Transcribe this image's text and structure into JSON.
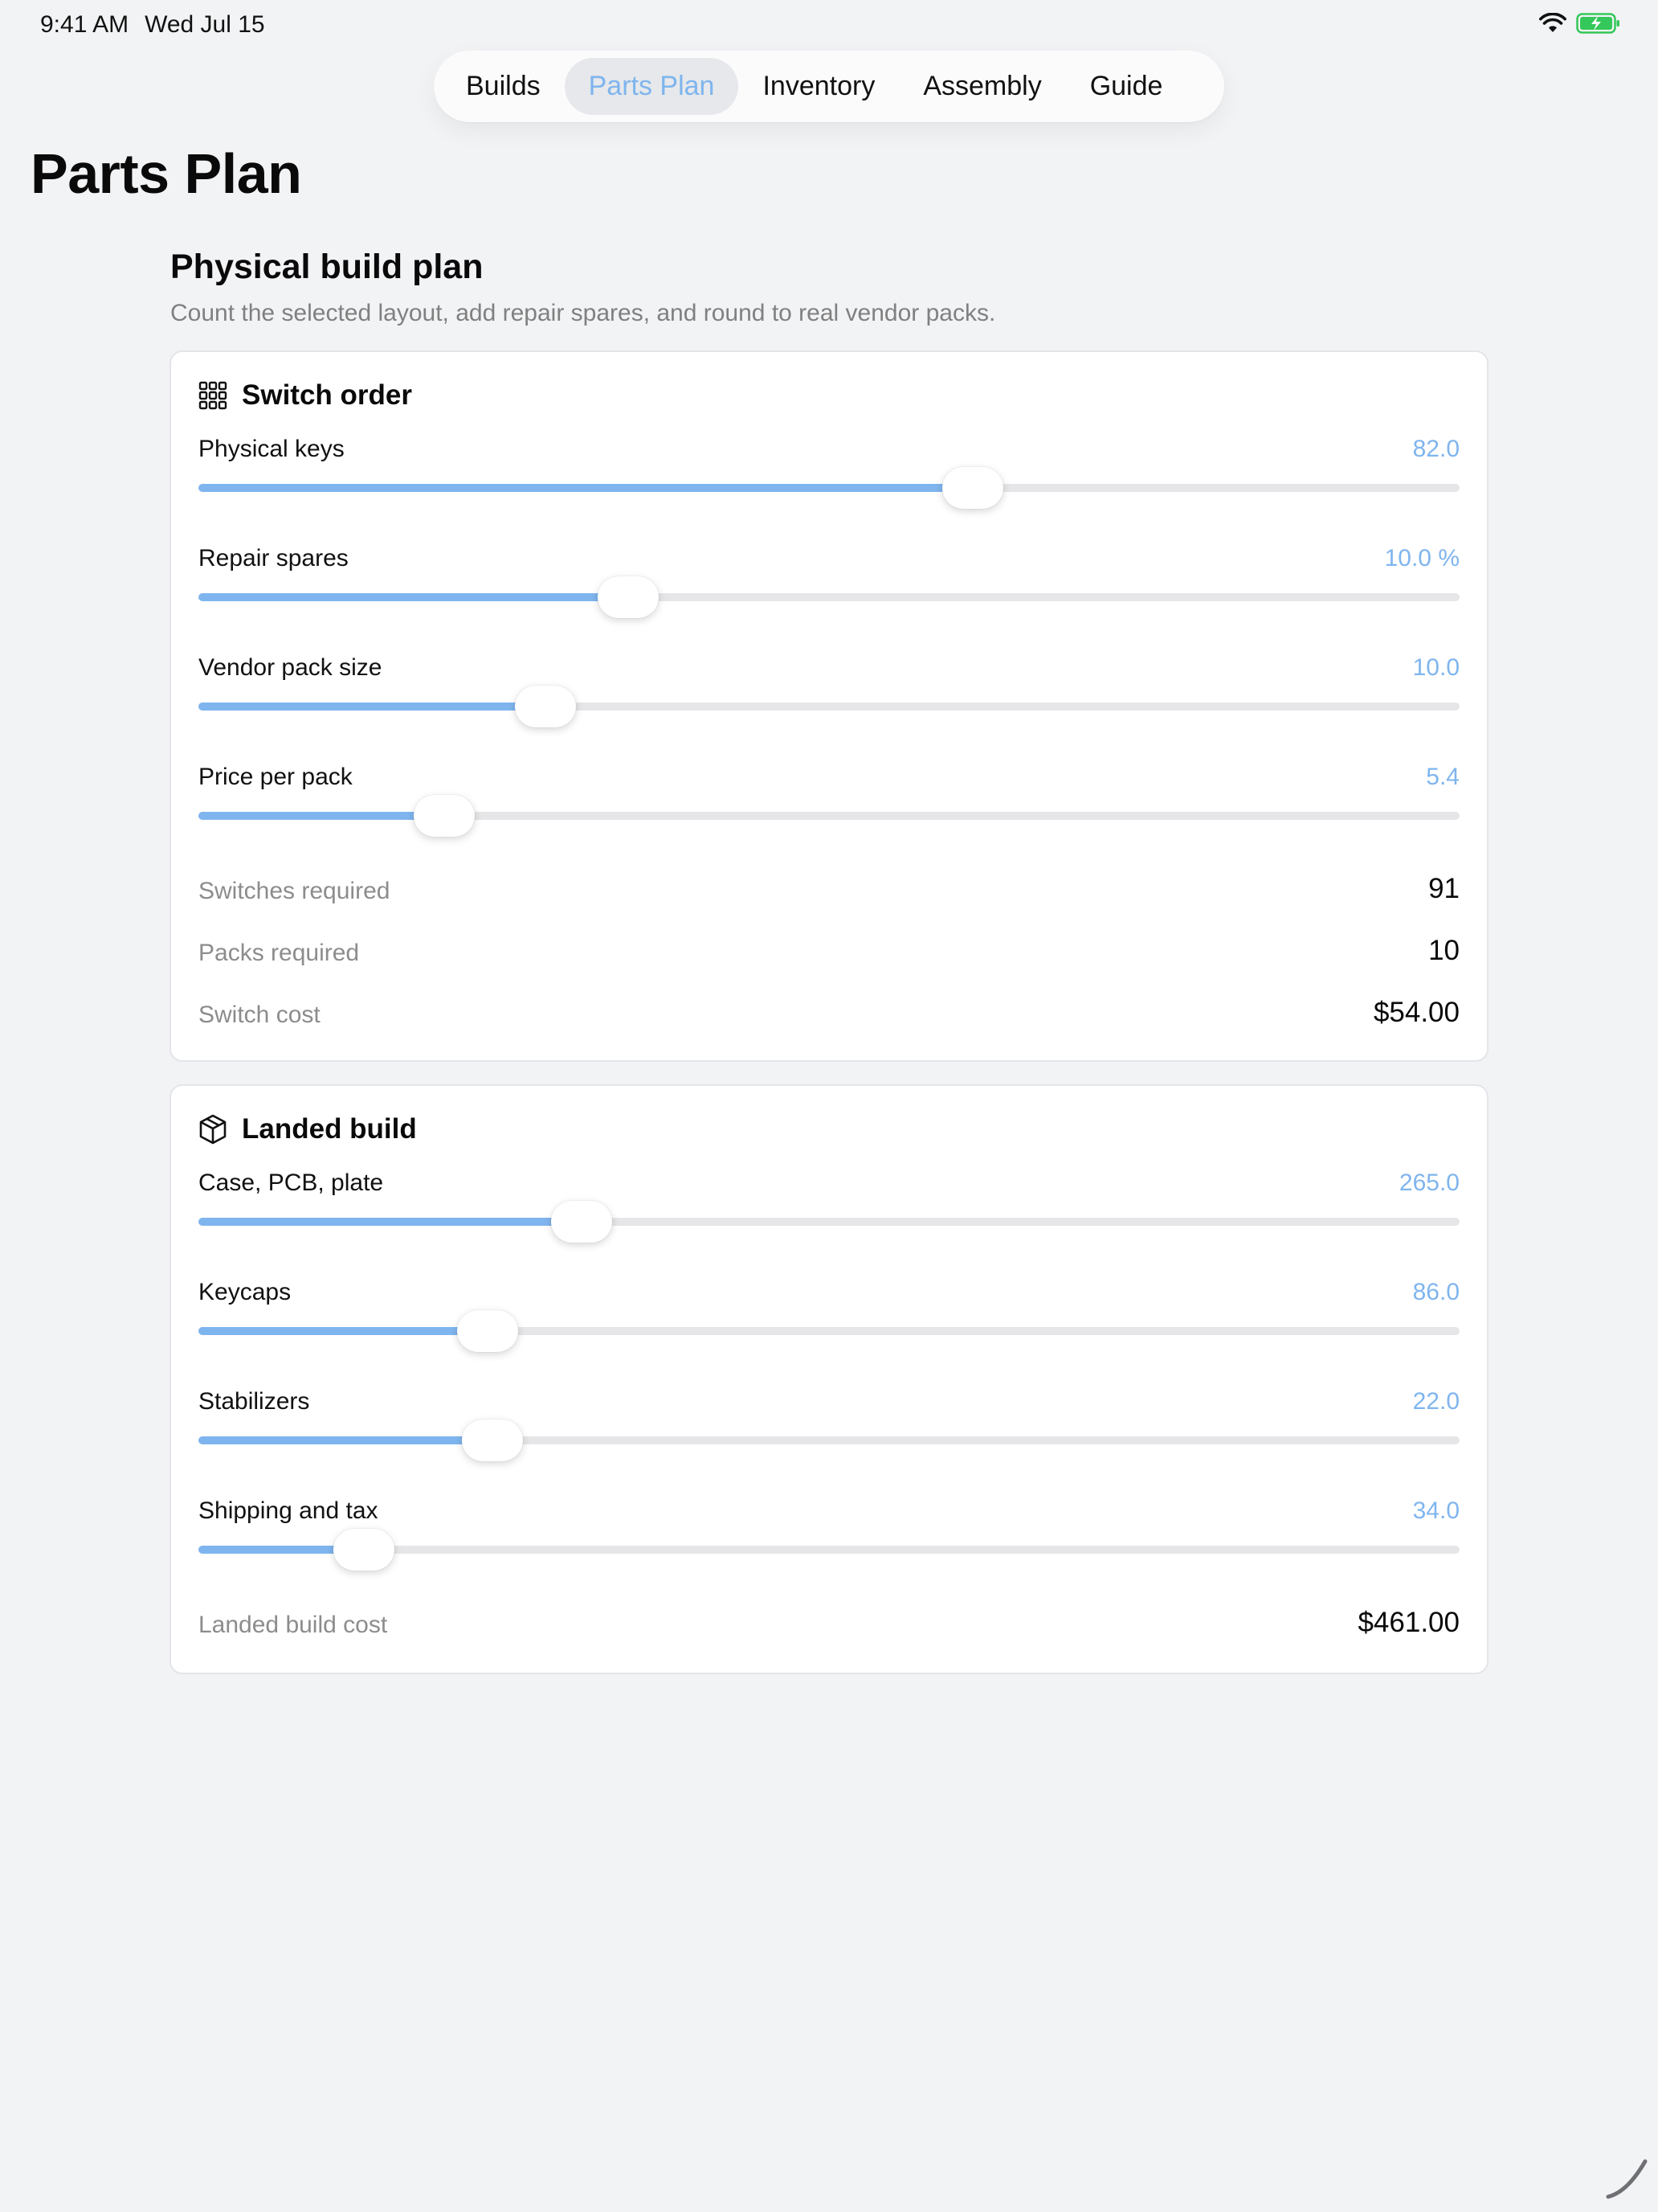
{
  "status": {
    "time": "9:41 AM",
    "date": "Wed Jul 15"
  },
  "tabs": [
    {
      "label": "Builds",
      "active": false
    },
    {
      "label": "Parts Plan",
      "active": true
    },
    {
      "label": "Inventory",
      "active": false
    },
    {
      "label": "Assembly",
      "active": false
    },
    {
      "label": "Guide",
      "active": false
    }
  ],
  "page_title": "Parts Plan",
  "section": {
    "title": "Physical build plan",
    "subtitle": "Count the selected layout, add repair spares, and round to real vendor packs."
  },
  "accent_color": "#7fb5ee",
  "switch_order": {
    "title": "Switch order",
    "icon": "keyboard-grid-icon",
    "sliders": [
      {
        "label": "Physical keys",
        "value": "82.0",
        "fraction": 0.614
      },
      {
        "label": "Repair spares",
        "value": "10.0 %",
        "fraction": 0.341
      },
      {
        "label": "Vendor pack size",
        "value": "10.0",
        "fraction": 0.275
      },
      {
        "label": "Price per pack",
        "value": "5.4",
        "fraction": 0.195
      }
    ],
    "results": [
      {
        "label": "Switches required",
        "value": "91"
      },
      {
        "label": "Packs required",
        "value": "10"
      },
      {
        "label": "Switch cost",
        "value": "$54.00"
      }
    ]
  },
  "landed_build": {
    "title": "Landed build",
    "icon": "package-box-icon",
    "sliders": [
      {
        "label": "Case, PCB, plate",
        "value": "265.0",
        "fraction": 0.304
      },
      {
        "label": "Keycaps",
        "value": "86.0",
        "fraction": 0.229
      },
      {
        "label": "Stabilizers",
        "value": "22.0",
        "fraction": 0.233
      },
      {
        "label": "Shipping and tax",
        "value": "34.0",
        "fraction": 0.131
      }
    ],
    "results": [
      {
        "label": "Landed build cost",
        "value": "$461.00"
      }
    ]
  }
}
